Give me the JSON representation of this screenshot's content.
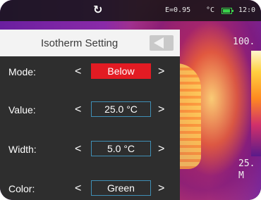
{
  "status_bar": {
    "emissivity": "E=0.95",
    "unit": "°C",
    "clock": "12:0"
  },
  "thermal_scale": {
    "max": "100.",
    "min": "25.",
    "min_suffix": "M"
  },
  "panel": {
    "title": "Isotherm Setting",
    "rows": [
      {
        "label": "Mode:",
        "value": "Below"
      },
      {
        "label": "Value:",
        "value": "25.0 °C"
      },
      {
        "label": "Width:",
        "value": "5.0 °C"
      },
      {
        "label": "Color:",
        "value": "Green"
      }
    ],
    "prev_glyph": "<",
    "next_glyph": ">"
  },
  "colors": {
    "selected_value_bg": "#e31b23",
    "value_border": "#3f8fb6",
    "panel_bg": "#2e2e2e"
  },
  "icons": {
    "refresh": "refresh-icon",
    "battery": "battery-icon",
    "back": "back-arrow-icon"
  }
}
